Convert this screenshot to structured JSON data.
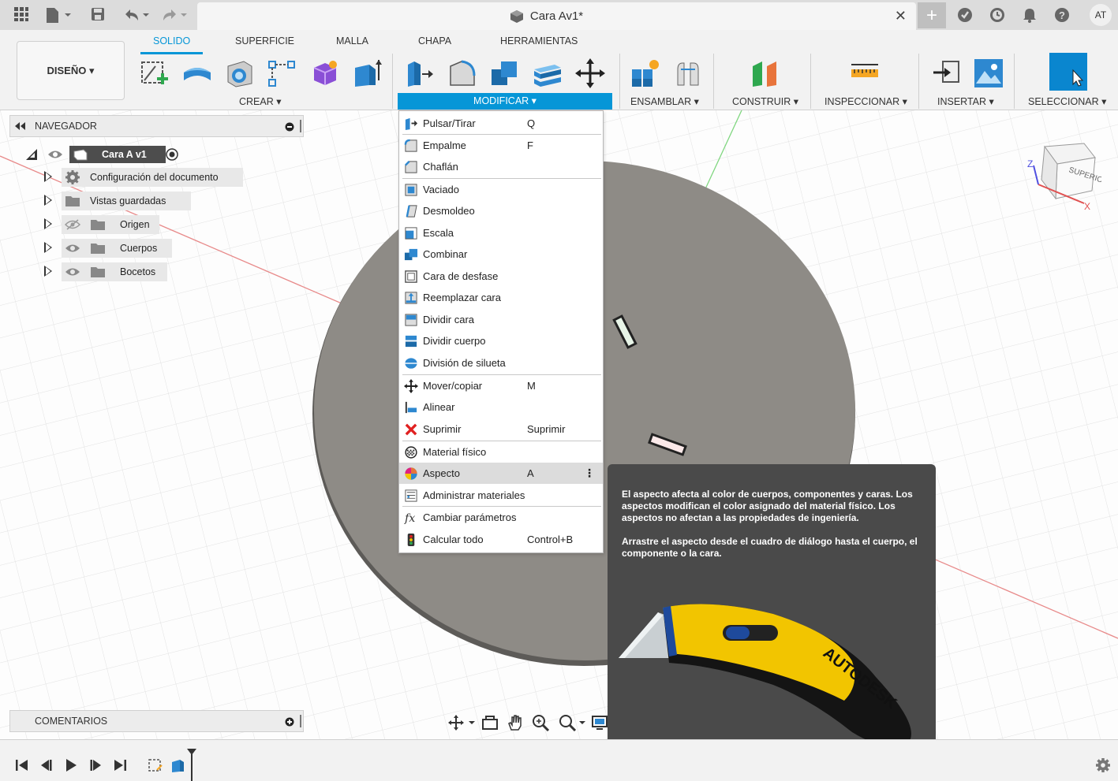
{
  "window": {
    "document_title": "Cara Av1*",
    "user_initials": "AT"
  },
  "ribbon": {
    "workspace_button": "DISEÑO ▾",
    "tabs": [
      "SOLIDO",
      "SUPERFICIE",
      "MALLA",
      "CHAPA",
      "HERRAMIENTAS"
    ],
    "active_tab": "SOLIDO",
    "groups": {
      "crear": "CREAR ▾",
      "modificar": "MODIFICAR ▾",
      "ensamblar": "ENSAMBLAR ▾",
      "construir": "CONSTRUIR ▾",
      "inspeccionar": "INSPECCIONAR ▾",
      "insertar": "INSERTAR ▾",
      "seleccionar": "SELECCIONAR ▾"
    }
  },
  "navigator": {
    "title": "NAVEGADOR",
    "root": "Cara A v1",
    "items": [
      {
        "label": "Configuración del documento",
        "icon": "gear-icon"
      },
      {
        "label": "Vistas guardadas",
        "icon": "folder-icon"
      },
      {
        "label": "Origen",
        "icon": "folder-icon",
        "visibility": "hidden"
      },
      {
        "label": "Cuerpos",
        "icon": "folder-icon",
        "visibility": "visible"
      },
      {
        "label": "Bocetos",
        "icon": "folder-icon",
        "visibility": "visible"
      }
    ]
  },
  "comments": {
    "title": "COMENTARIOS"
  },
  "viewcube": {
    "face_label": "SUPERIOR",
    "axis_z": "Z",
    "axis_x": "X"
  },
  "modify_menu": {
    "items": [
      {
        "label": "Pulsar/Tirar",
        "shortcut": "Q",
        "icon": "push-pull-icon"
      },
      {
        "label": "Empalme",
        "shortcut": "F",
        "icon": "fillet-icon"
      },
      {
        "label": "Chaflán",
        "shortcut": "",
        "icon": "chamfer-icon"
      },
      {
        "label": "Vaciado",
        "shortcut": "",
        "icon": "shell-icon"
      },
      {
        "label": "Desmoldeo",
        "shortcut": "",
        "icon": "draft-icon"
      },
      {
        "label": "Escala",
        "shortcut": "",
        "icon": "scale-icon"
      },
      {
        "label": "Combinar",
        "shortcut": "",
        "icon": "combine-icon"
      },
      {
        "label": "Cara de desfase",
        "shortcut": "",
        "icon": "offset-face-icon"
      },
      {
        "label": "Reemplazar cara",
        "shortcut": "",
        "icon": "replace-face-icon"
      },
      {
        "label": "Dividir cara",
        "shortcut": "",
        "icon": "split-face-icon"
      },
      {
        "label": "Dividir cuerpo",
        "shortcut": "",
        "icon": "split-body-icon"
      },
      {
        "label": "División de silueta",
        "shortcut": "",
        "icon": "silhouette-split-icon"
      },
      {
        "label": "Mover/copiar",
        "shortcut": "M",
        "icon": "move-icon"
      },
      {
        "label": "Alinear",
        "shortcut": "",
        "icon": "align-icon"
      },
      {
        "label": "Suprimir",
        "shortcut": "Suprimir",
        "icon": "delete-icon"
      },
      {
        "label": "Material físico",
        "shortcut": "",
        "icon": "physical-material-icon"
      },
      {
        "label": "Aspecto",
        "shortcut": "A",
        "icon": "appearance-icon"
      },
      {
        "label": "Administrar materiales",
        "shortcut": "",
        "icon": "manage-materials-icon"
      },
      {
        "label": "Cambiar parámetros",
        "shortcut": "",
        "icon": "parameters-icon"
      },
      {
        "label": "Calcular todo",
        "shortcut": "Control+B",
        "icon": "compute-all-icon"
      }
    ],
    "highlighted": "Aspecto"
  },
  "tooltip": {
    "paragraph1": "El aspecto afecta al color de cuerpos, componentes y caras. Los aspectos modifican el color asignado del material físico. Los aspectos no afectan a las propiedades de ingeniería.",
    "paragraph2": "Arrastre el aspecto desde el cuadro de diálogo hasta el cuerpo, el componente o la cara.",
    "image_brand": "AUTODESK"
  },
  "colors": {
    "accent": "#0696d7",
    "body_gray": "#8e8b86",
    "tooltip_bg": "#4a4a4a",
    "knife_yellow": "#f2c500"
  }
}
